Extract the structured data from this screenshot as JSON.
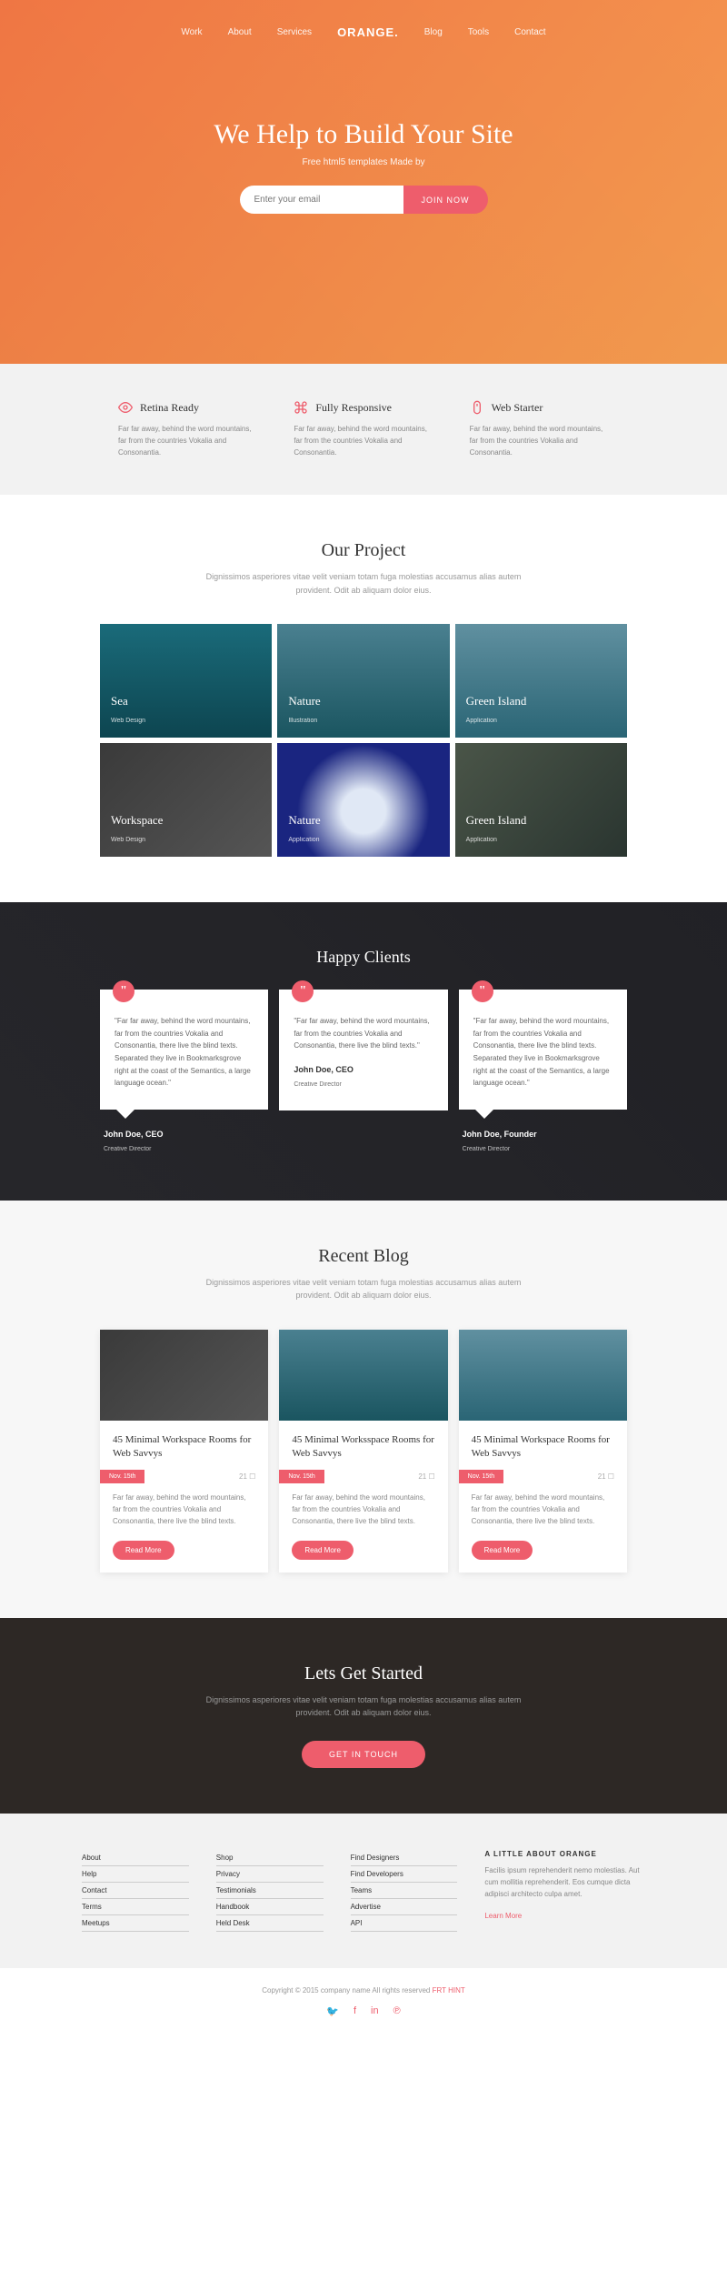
{
  "nav": {
    "items": [
      "Work",
      "About",
      "Services"
    ],
    "logo": "ORANGE.",
    "items2": [
      "Blog",
      "Tools",
      "Contact"
    ]
  },
  "hero": {
    "title": "We Help to Build Your Site",
    "subtitle": "Free html5 templates Made by",
    "placeholder": "Enter your email",
    "button": "JOIN NOW"
  },
  "features": [
    {
      "title": "Retina Ready",
      "text": "Far far away, behind the word mountains, far from the countries Vokalia and Consonantia."
    },
    {
      "title": "Fully Responsive",
      "text": "Far far away, behind the word mountains, far from the countries Vokalia and Consonantia."
    },
    {
      "title": "Web Starter",
      "text": "Far far away, behind the word mountains, far from the countries Vokalia and Consonantia."
    }
  ],
  "projects": {
    "title": "Our Project",
    "subtitle": "Dignissimos asperiores vitae velit veniam totam fuga molestias accusamus alias autem provident. Odit ab aliquam dolor eius.",
    "items": [
      {
        "title": "Sea",
        "cat": "Web Design"
      },
      {
        "title": "Nature",
        "cat": "Illustration"
      },
      {
        "title": "Green Island",
        "cat": "Application"
      },
      {
        "title": "Workspace",
        "cat": "Web Design"
      },
      {
        "title": "Nature",
        "cat": "Application"
      },
      {
        "title": "Green Island",
        "cat": "Application"
      }
    ]
  },
  "clients": {
    "title": "Happy Clients",
    "items": [
      {
        "text": "\"Far far away, behind the word mountains, far from the countries Vokalia and Consonantia, there live the blind texts. Separated they live in Bookmarksgrove right at the coast of the Semantics, a large language ocean.\"",
        "name": "John Doe, CEO",
        "role": "Creative Director",
        "external": true
      },
      {
        "text": "\"Far far away, behind the word mountains, far from the countries Vokalia and Consonantia, there live the blind texts.\"",
        "name": "John Doe, CEO",
        "role": "Creative Director",
        "external": false
      },
      {
        "text": "\"Far far away, behind the word mountains, far from the countries Vokalia and Consonantia, there live the blind texts. Separated they live in Bookmarksgrove right at the coast of the Semantics, a large language ocean.\"",
        "name": "John Doe, Founder",
        "role": "Creative Director",
        "external": true
      }
    ]
  },
  "blog": {
    "title": "Recent Blog",
    "subtitle": "Dignissimos asperiores vitae velit veniam totam fuga molestias accusamus alias autem provident. Odit ab aliquam dolor eius.",
    "items": [
      {
        "title": "45 Minimal Workspace Rooms for Web Savvys",
        "date": "Nov. 15th",
        "comments": "21 ☐",
        "text": "Far far away, behind the word mountains, far from the countries Vokalia and Consonantia, there live the blind texts.",
        "btn": "Read More"
      },
      {
        "title": "45 Minimal Worksspace Rooms for Web Savvys",
        "date": "Nov. 15th",
        "comments": "21 ☐",
        "text": "Far far away, behind the word mountains, far from the countries Vokalia and Consonantia, there live the blind texts.",
        "btn": "Read More"
      },
      {
        "title": "45 Minimal Workspace Rooms for Web Savvys",
        "date": "Nov. 15th",
        "comments": "21 ☐",
        "text": "Far far away, behind the word mountains, far from the countries Vokalia and Consonantia, there live the blind texts.",
        "btn": "Read More"
      }
    ]
  },
  "cta": {
    "title": "Lets Get Started",
    "subtitle": "Dignissimos asperiores vitae velit veniam totam fuga molestias accusamus alias autem provident. Odit ab aliquam dolor eius.",
    "button": "GET IN TOUCH"
  },
  "footer": {
    "cols": [
      [
        "About",
        "Help",
        "Contact",
        "Terms",
        "Meetups"
      ],
      [
        "Shop",
        "Privacy",
        "Testimonials",
        "Handbook",
        "Held Desk"
      ],
      [
        "Find Designers",
        "Find Developers",
        "Teams",
        "Advertise",
        "API"
      ]
    ],
    "about": {
      "title": "A LITTLE ABOUT ORANGE",
      "text": "Facilis ipsum reprehenderit nemo molestias. Aut cum mollitia reprehenderit. Eos cumque dicta adipisci architecto culpa amet.",
      "link": "Learn More"
    }
  },
  "bottom": {
    "copyright": "Copyright © 2015 company name All rights reserved ",
    "brand": "FRT HINT",
    "socials": [
      "twitter",
      "facebook",
      "linkedin",
      "pinterest"
    ]
  }
}
